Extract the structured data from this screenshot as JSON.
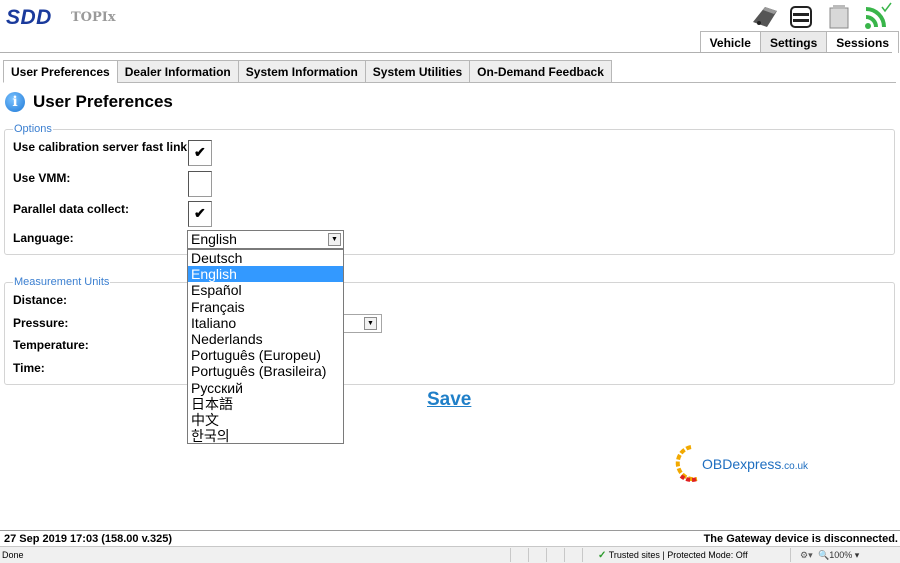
{
  "header": {
    "logo": "SDD",
    "app_name": "TOPIx",
    "icons": [
      "vehicle-icon",
      "settings-icon",
      "sessions-icon",
      "connection-icon"
    ],
    "tabs": [
      {
        "label": "Vehicle",
        "active": false
      },
      {
        "label": "Settings",
        "active": true
      },
      {
        "label": "Sessions",
        "active": false
      }
    ]
  },
  "sub_tabs": [
    {
      "label": "User Preferences",
      "active": true
    },
    {
      "label": "Dealer Information",
      "active": false
    },
    {
      "label": "System Information",
      "active": false
    },
    {
      "label": "System Utilities",
      "active": false
    },
    {
      "label": "On-Demand Feedback",
      "active": false
    }
  ],
  "page": {
    "title": "User Preferences",
    "options": {
      "legend": "Options",
      "fast_link_label": "Use calibration server fast link:",
      "fast_link_checked": true,
      "vmm_label": "Use VMM:",
      "vmm_checked": false,
      "parallel_label": "Parallel data collect:",
      "parallel_checked": true,
      "language_label": "Language:",
      "language_value": "English",
      "language_options": [
        "Deutsch",
        "English",
        "Español",
        "Français",
        "Italiano",
        "Nederlands",
        "Português (Europeu)",
        "Português (Brasileira)",
        "Русский",
        "日本語",
        "中文",
        "한국의"
      ],
      "language_highlighted": "English"
    },
    "units": {
      "legend": "Measurement Units",
      "distance_label": "Distance:",
      "pressure_label": "Pressure:",
      "temperature_label": "Temperature:",
      "time_label": "Time:"
    },
    "save_label": "Save"
  },
  "watermark": {
    "text": "OBDexpress",
    "suffix": ".co.uk"
  },
  "footer": {
    "timestamp": "27 Sep 2019 17:03 (158.00 v.325)",
    "status": "The Gateway device is disconnected."
  },
  "statusbar": {
    "left": "Done",
    "zone": "Trusted sites | Protected Mode: Off",
    "zoom": "100%"
  },
  "colors": {
    "accent": "#1f7fc8",
    "logo": "#1a3a9c",
    "selection": "#3399ff",
    "legend": "#3b7fd0"
  }
}
